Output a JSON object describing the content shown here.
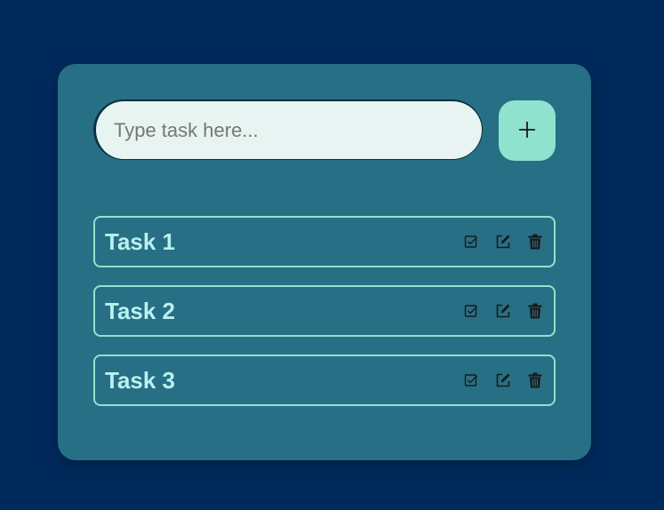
{
  "input": {
    "placeholder": "Type task here...",
    "value": ""
  },
  "add_button": {
    "icon": "plus-icon"
  },
  "tasks": [
    {
      "label": "Task 1"
    },
    {
      "label": "Task 2"
    },
    {
      "label": "Task 3"
    }
  ],
  "task_actions": [
    {
      "icon": "check-square-icon"
    },
    {
      "icon": "edit-icon"
    },
    {
      "icon": "trash-icon"
    }
  ],
  "colors": {
    "page_background": "#002a5c",
    "card_background": "#276f85",
    "accent": "#8fe3cf",
    "task_text": "#b9f1ee",
    "input_background": "#e8f4f1"
  }
}
